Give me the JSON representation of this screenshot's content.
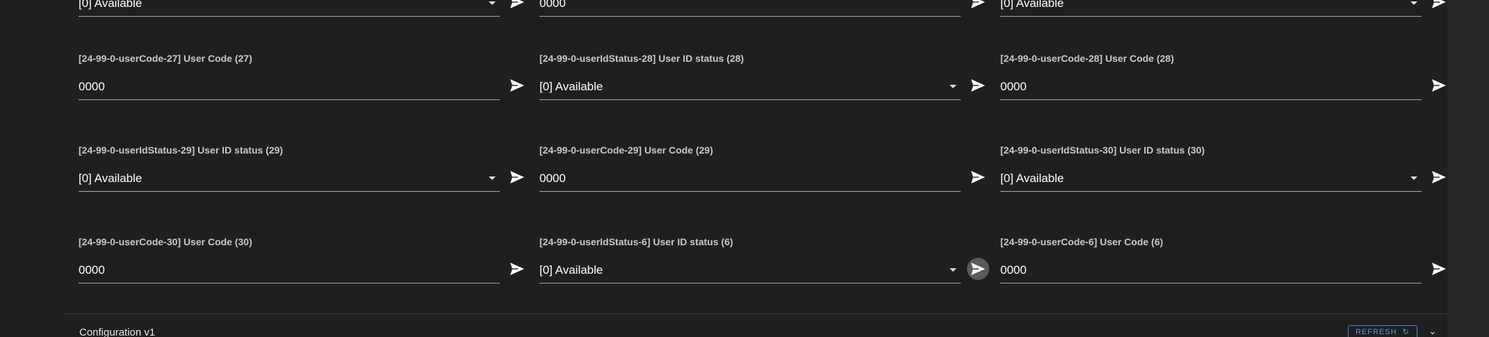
{
  "rows": [
    [
      {
        "label": "",
        "value": "[0] Available",
        "type": "select"
      },
      {
        "label": "",
        "value": "0000",
        "type": "text"
      },
      {
        "label": "",
        "value": "[0] Available",
        "type": "select"
      }
    ],
    [
      {
        "label": "[24-99-0-userCode-27] User Code (27)",
        "value": "0000",
        "type": "text"
      },
      {
        "label": "[24-99-0-userIdStatus-28] User ID status (28)",
        "value": "[0] Available",
        "type": "select"
      },
      {
        "label": "[24-99-0-userCode-28] User Code (28)",
        "value": "0000",
        "type": "text"
      }
    ],
    [
      {
        "label": "[24-99-0-userIdStatus-29] User ID status (29)",
        "value": "[0] Available",
        "type": "select"
      },
      {
        "label": "[24-99-0-userCode-29] User Code (29)",
        "value": "0000",
        "type": "text"
      },
      {
        "label": "[24-99-0-userIdStatus-30] User ID status (30)",
        "value": "[0] Available",
        "type": "select"
      }
    ],
    [
      {
        "label": "[24-99-0-userCode-30] User Code (30)",
        "value": "0000",
        "type": "text"
      },
      {
        "label": "[24-99-0-userIdStatus-6] User ID status (6)",
        "value": "[0] Available",
        "type": "select",
        "send_hovered": true
      },
      {
        "label": "[24-99-0-userCode-6] User Code (6)",
        "value": "0000",
        "type": "text"
      }
    ]
  ],
  "config_section": {
    "title": "Configuration v1",
    "refresh_label": "REFRESH",
    "refresh_icon": "refresh-icon",
    "expand_icon": "chevron-down-icon"
  },
  "colors": {
    "background": "#1f1f1f",
    "label": "#c8c8c8",
    "value": "#ffffff",
    "underline": "#a8a8a8",
    "accent": "#5a9ae8"
  }
}
